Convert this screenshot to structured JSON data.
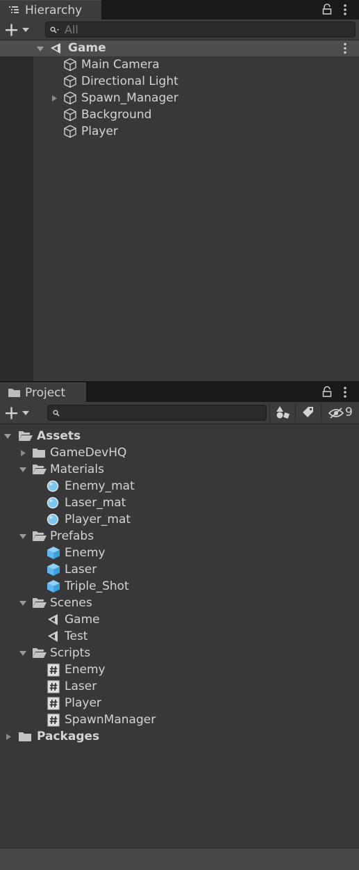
{
  "hierarchy": {
    "tab_label": "Hierarchy",
    "search_placeholder": "All",
    "scene": "Game",
    "objects": [
      "Main Camera",
      "Directional Light",
      "Spawn_Manager",
      "Background",
      "Player"
    ]
  },
  "project": {
    "tab_label": "Project",
    "hidden_packages_count": "9",
    "tree": {
      "assets": "Assets",
      "gamedevhq": "GameDevHQ",
      "materials": {
        "label": "Materials",
        "items": [
          "Enemy_mat",
          "Laser_mat",
          "Player_mat"
        ]
      },
      "prefabs": {
        "label": "Prefabs",
        "items": [
          "Enemy",
          "Laser",
          "Triple_Shot"
        ]
      },
      "scenes": {
        "label": "Scenes",
        "items": [
          "Game",
          "Test"
        ]
      },
      "scripts": {
        "label": "Scripts",
        "items": [
          "Enemy",
          "Laser",
          "Player",
          "SpawnManager"
        ]
      },
      "packages": "Packages"
    }
  },
  "colors": {
    "panel": "#383838",
    "tab_bar": "#191919",
    "selected_row": "#4d4d4d",
    "material_icon": "#7cc6f0",
    "prefab_icon": "#5cb8f0"
  }
}
